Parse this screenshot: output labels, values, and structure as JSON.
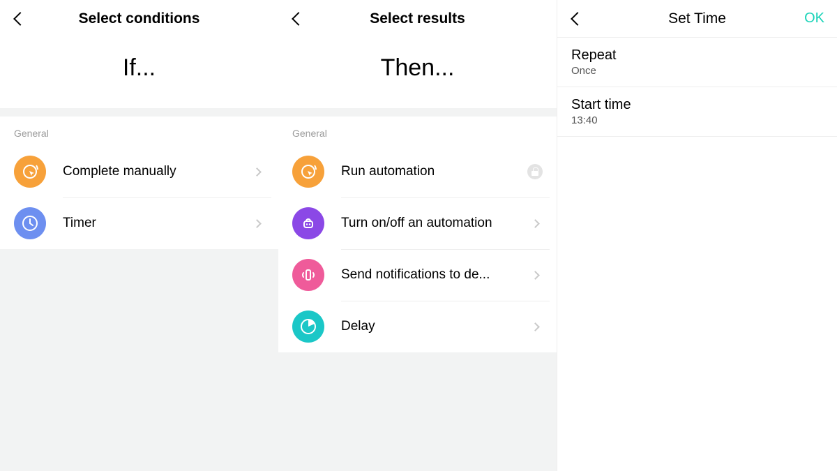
{
  "panel1": {
    "header_title": "Select conditions",
    "hero": "If...",
    "section": "General",
    "items": [
      {
        "label": "Complete manually",
        "color": "orange",
        "icon": "cursor-circle",
        "trailing": "chev"
      },
      {
        "label": "Timer",
        "color": "blue",
        "icon": "clock",
        "trailing": "chev"
      }
    ]
  },
  "panel2": {
    "header_title": "Select results",
    "hero": "Then...",
    "section": "General",
    "items": [
      {
        "label": "Run automation",
        "color": "orange",
        "icon": "cursor-circle",
        "trailing": "lock"
      },
      {
        "label": "Turn on/off an automation",
        "color": "purple",
        "icon": "robot",
        "trailing": "chev"
      },
      {
        "label": "Send notifications to de...",
        "color": "pink",
        "icon": "phone-vibrate",
        "trailing": "chev"
      },
      {
        "label": "Delay",
        "color": "teal",
        "icon": "pie-clock",
        "trailing": "chev"
      }
    ]
  },
  "panel3": {
    "header_title": "Set Time",
    "action": "OK",
    "rows": [
      {
        "title": "Repeat",
        "value": "Once"
      },
      {
        "title": "Start time",
        "value": "13:40"
      }
    ]
  }
}
